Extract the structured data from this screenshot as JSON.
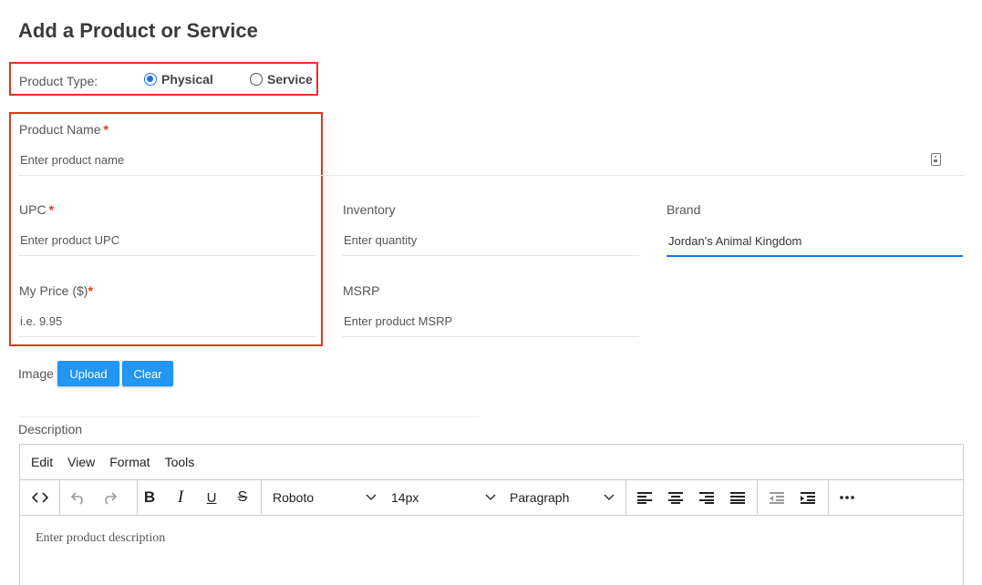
{
  "page": {
    "title": "Add a Product or Service"
  },
  "product_type": {
    "label": "Product Type:",
    "options": [
      {
        "label": "Physical",
        "checked": true
      },
      {
        "label": "Service",
        "checked": false
      }
    ]
  },
  "fields": {
    "product_name": {
      "label": "Product Name",
      "required_mark": "*",
      "placeholder": "Enter product name",
      "value": ""
    },
    "upc": {
      "label": "UPC",
      "required_mark": "*",
      "placeholder": "Enter product UPC",
      "value": ""
    },
    "inventory": {
      "label": "Inventory",
      "placeholder": "Enter quantity",
      "value": ""
    },
    "brand": {
      "label": "Brand",
      "placeholder": "",
      "value": "Jordan's Animal Kingdom"
    },
    "my_price": {
      "label": "My Price ($)",
      "required_mark": "*",
      "placeholder": "i.e. 9.95",
      "value": ""
    },
    "msrp": {
      "label": "MSRP",
      "placeholder": "Enter product MSRP",
      "value": ""
    }
  },
  "image": {
    "label": "Image",
    "upload_label": "Upload",
    "clear_label": "Clear"
  },
  "description": {
    "label": "Description",
    "menu": [
      "Edit",
      "View",
      "Format",
      "Tools"
    ],
    "font_family": "Roboto",
    "font_size": "14px",
    "block_format": "Paragraph",
    "placeholder": "Enter product description"
  },
  "colors": {
    "accent": "#2196f3",
    "highlight_border": "#e8331d",
    "required": "#e8331d",
    "focus_underline": "#1a73e8"
  }
}
